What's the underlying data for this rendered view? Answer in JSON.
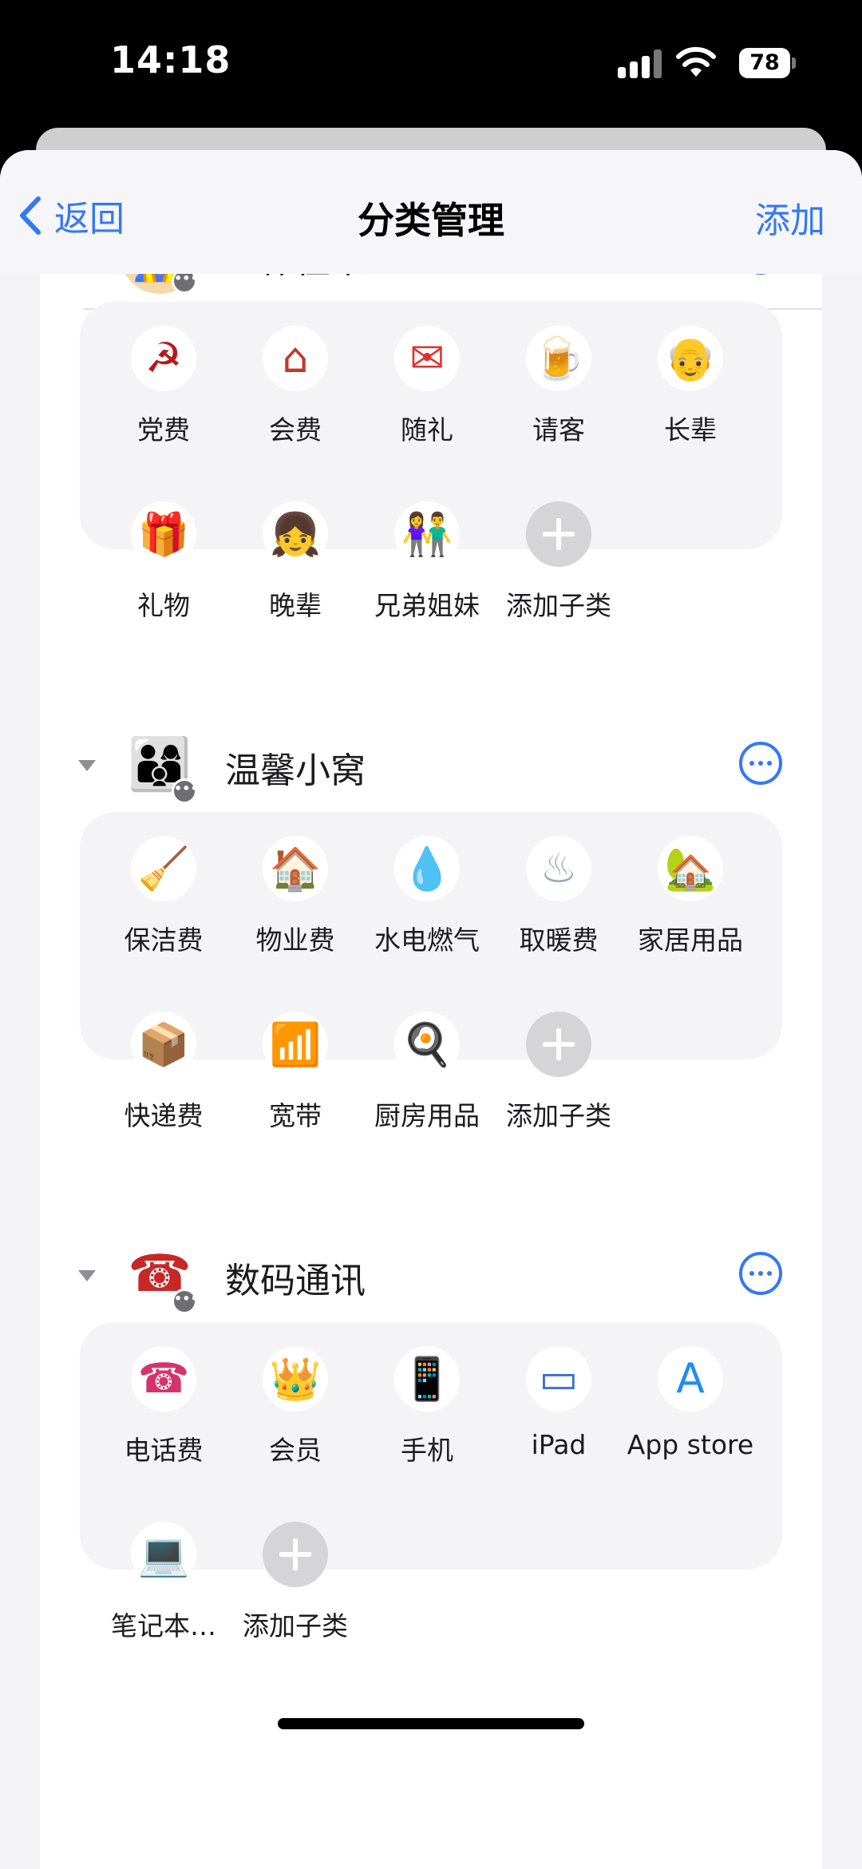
{
  "status_bar": {
    "time": "14:18",
    "battery": "78"
  },
  "nav": {
    "back_label": "返回",
    "title": "分类管理",
    "add_label": "添加"
  },
  "groups": [
    {
      "title": "工作往来",
      "avatar_icon": "worker-icon",
      "items": [
        {
          "label": "党费",
          "icon": "party-emblem-icon",
          "glyph": "☭",
          "color": "#b31b1b"
        },
        {
          "label": "会费",
          "icon": "union-house-icon",
          "glyph": "⌂",
          "color": "#c0392b"
        },
        {
          "label": "随礼",
          "icon": "red-envelope-icon",
          "glyph": "✉",
          "color": "#e2302a"
        },
        {
          "label": "请客",
          "icon": "beer-icon",
          "glyph": "🍺",
          "color": "#e8a33a"
        },
        {
          "label": "长辈",
          "icon": "elders-icon",
          "glyph": "👴",
          "color": "#8a8a8a"
        },
        {
          "label": "礼物",
          "icon": "gift-icon",
          "glyph": "🎁",
          "color": "#d48a1f"
        },
        {
          "label": "晚辈",
          "icon": "children-icon",
          "glyph": "👧",
          "color": "#e86a9a"
        },
        {
          "label": "兄弟姐妹",
          "icon": "siblings-icon",
          "glyph": "👫",
          "color": "#2e8b57"
        },
        {
          "label": "添加子类",
          "icon": "add-icon",
          "add": true
        }
      ]
    },
    {
      "title": "温馨小窝",
      "avatar_icon": "family-icon",
      "items": [
        {
          "label": "保洁费",
          "icon": "cleaner-icon",
          "glyph": "🧹",
          "color": "#c08a5a"
        },
        {
          "label": "物业费",
          "icon": "property-icon",
          "glyph": "🏠",
          "color": "#2f6b3a"
        },
        {
          "label": "水电燃气",
          "icon": "water-drop-icon",
          "glyph": "💧",
          "color": "#2a9db5"
        },
        {
          "label": "取暖费",
          "icon": "radiator-icon",
          "glyph": "♨",
          "color": "#9aa8b8"
        },
        {
          "label": "家居用品",
          "icon": "home-goods-icon",
          "glyph": "🏡",
          "color": "#3b6fa0"
        },
        {
          "label": "快递费",
          "icon": "courier-icon",
          "glyph": "📦",
          "color": "#4a78b0"
        },
        {
          "label": "宽带",
          "icon": "wifi-pin-icon",
          "glyph": "📶",
          "color": "#3fa66a"
        },
        {
          "label": "厨房用品",
          "icon": "kitchen-icon",
          "glyph": "🍳",
          "color": "#2e6b52"
        },
        {
          "label": "添加子类",
          "icon": "add-icon",
          "add": true
        }
      ]
    },
    {
      "title": "数码通讯",
      "avatar_icon": "telephone-icon",
      "items": [
        {
          "label": "电话费",
          "icon": "phone-icon",
          "glyph": "☎",
          "color": "#d6336c"
        },
        {
          "label": "会员",
          "icon": "crown-icon",
          "glyph": "👑",
          "color": "#e0a21a"
        },
        {
          "label": "手机",
          "icon": "smartphone-icon",
          "glyph": "📱",
          "color": "#6b5a48"
        },
        {
          "label": "iPad",
          "icon": "tablet-icon",
          "glyph": "▭",
          "color": "#3b6fd8"
        },
        {
          "label": "App store",
          "icon": "app-store-icon",
          "glyph": "A",
          "color": "#1f8ef1"
        },
        {
          "label": "笔记本…",
          "icon": "laptop-icon",
          "glyph": "💻",
          "color": "#607d8b"
        },
        {
          "label": "添加子类",
          "icon": "add-icon",
          "add": true
        }
      ]
    }
  ]
}
